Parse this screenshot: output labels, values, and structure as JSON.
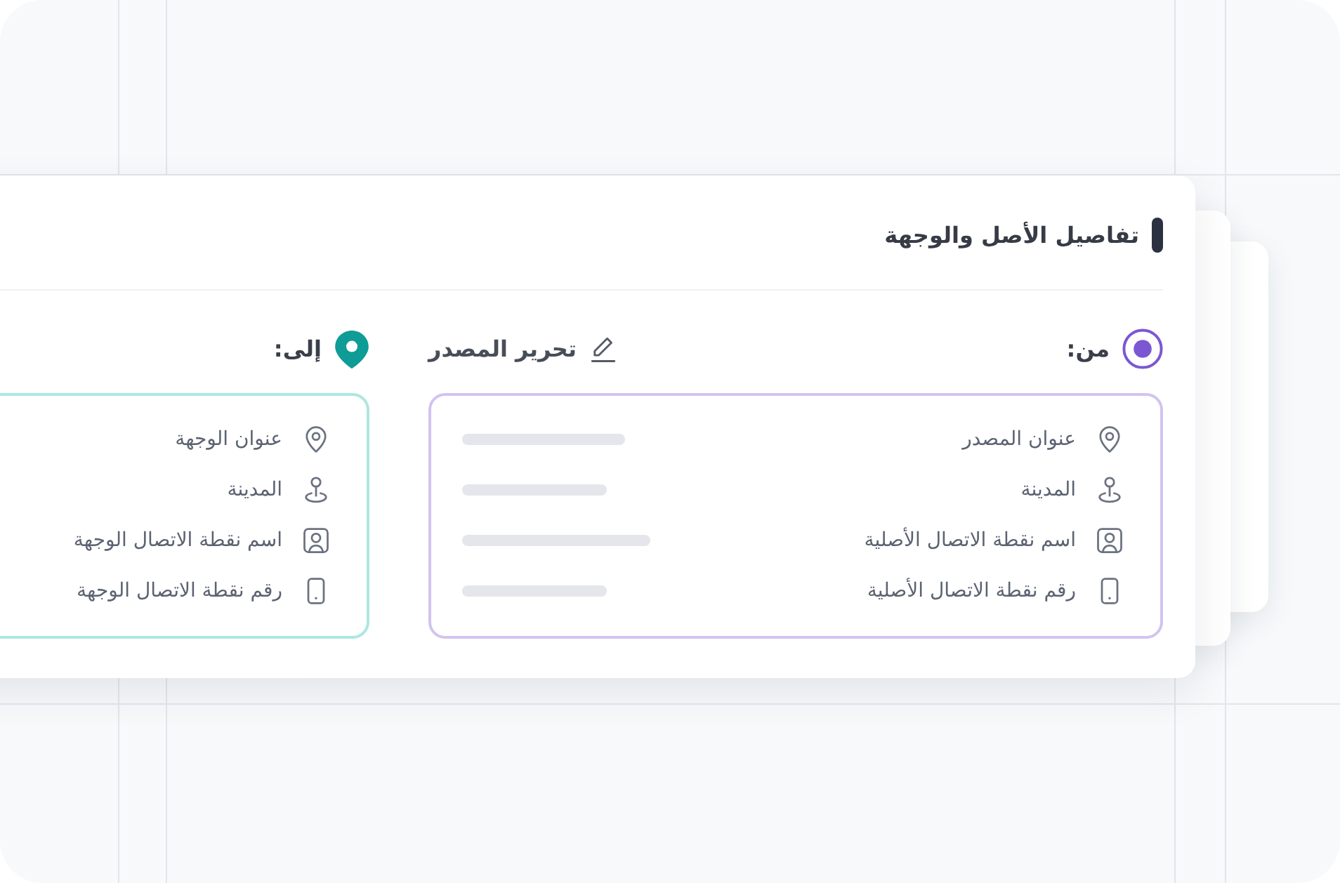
{
  "section": {
    "title": "تفاصيل الأصل والوجهة"
  },
  "panels": [
    {
      "kind": "origin",
      "label": "من:",
      "action": "تحرير المصدر",
      "fields": [
        {
          "kind": "address",
          "label": "عنوان المصدر",
          "loading": true
        },
        {
          "kind": "city",
          "label": "المدينة",
          "loading": true
        },
        {
          "kind": "contact_name",
          "label": "اسم نقطة الاتصال الأصلية",
          "loading": true
        },
        {
          "kind": "contact_phone",
          "label": "رقم نقطة الاتصال الأصلية",
          "loading": true
        }
      ]
    },
    {
      "kind": "destination",
      "label": "إلى:",
      "fields": [
        {
          "kind": "address",
          "label": "عنوان الوجهة"
        },
        {
          "kind": "city",
          "label": "المدينة"
        },
        {
          "kind": "contact_name",
          "label": "اسم نقطة الاتصال الوجهة"
        },
        {
          "kind": "contact_phone",
          "label": "رقم نقطة الاتصال الوجهة"
        }
      ]
    }
  ]
}
